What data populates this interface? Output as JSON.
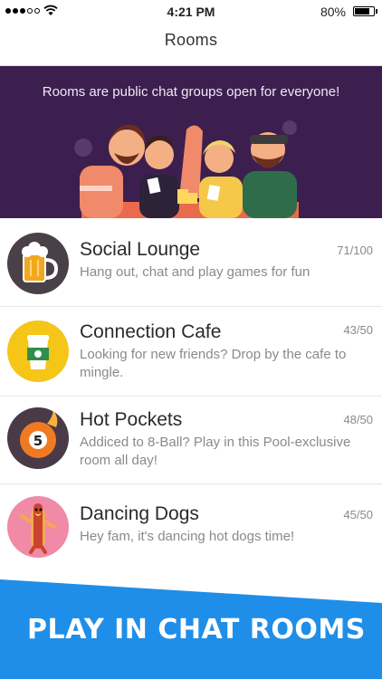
{
  "status_bar": {
    "time": "4:21 PM",
    "battery_percent": "80%",
    "battery_level": 0.8,
    "signal_bars": 3,
    "icons": [
      "signal-dots-icon",
      "wifi-icon",
      "battery-icon"
    ]
  },
  "nav": {
    "title": "Rooms"
  },
  "banner": {
    "text": "Rooms are public chat groups open for everyone!",
    "illustration": "group-of-friends-illustration"
  },
  "rooms": [
    {
      "name": "Social Lounge",
      "description": "Hang out, chat and play games for fun",
      "count": "71/100",
      "icon": "beer-mug-icon",
      "icon_bg": "#4a4047"
    },
    {
      "name": "Connection Cafe",
      "description": "Looking for new friends? Drop by the cafe to mingle.",
      "count": "43/50",
      "icon": "coffee-cup-icon",
      "icon_bg": "#f5c518"
    },
    {
      "name": "Hot Pockets",
      "description": "Addiced to 8-Ball? Play in this Pool-exclusive room all day!",
      "count": "48/50",
      "icon": "pool-ball-5-icon",
      "icon_bg": "#4a3a47"
    },
    {
      "name": "Dancing Dogs",
      "description": "Hey fam, it's dancing hot dogs time!",
      "count": "45/50",
      "icon": "hot-dog-icon",
      "icon_bg": "#f08aa6"
    }
  ],
  "footer": {
    "text": "PLAY IN CHAT ROOMS",
    "color": "#1f8ee8"
  },
  "colors": {
    "banner_bg": "#3d1f4f",
    "accent_blue": "#1f8ee8"
  }
}
